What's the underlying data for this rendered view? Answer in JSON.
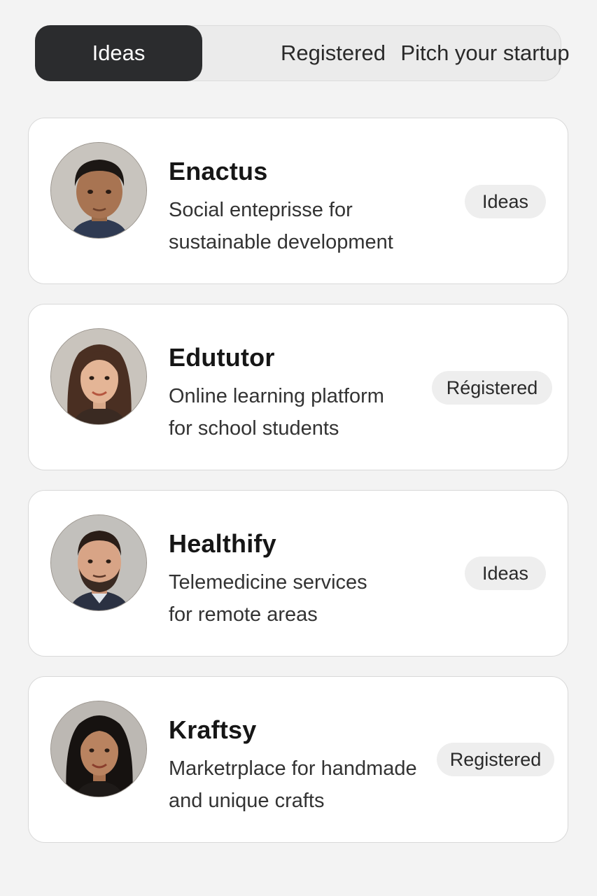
{
  "tabs": [
    {
      "label": "Ideas",
      "active": true
    },
    {
      "label": "Registered",
      "active": false
    },
    {
      "label": "Pitch your startup",
      "active": false
    }
  ],
  "cards": [
    {
      "title": "Enactus",
      "description": [
        "Social enteprisse for",
        "sustainable development"
      ],
      "badge": "Ideas",
      "avatar": "man-portrait"
    },
    {
      "title": "Edututor",
      "description": [
        "Online learning platform",
        "for school students"
      ],
      "badge": "Régistered",
      "avatar": "woman-portrait"
    },
    {
      "title": "Healthify",
      "description": [
        "Telemedicine services",
        "for remote areas"
      ],
      "badge": "Ideas",
      "avatar": "bearded-man-portrait"
    },
    {
      "title": "Kraftsy",
      "description": [
        "Marketrplace for handmade",
        "and unique crafts"
      ],
      "badge": "Registered",
      "avatar": "woman-portrait"
    }
  ],
  "colors": {
    "background": "#f3f3f3",
    "active_tab": "#2b2c2e",
    "card": "#ffffff",
    "badge": "#eeeeee"
  }
}
